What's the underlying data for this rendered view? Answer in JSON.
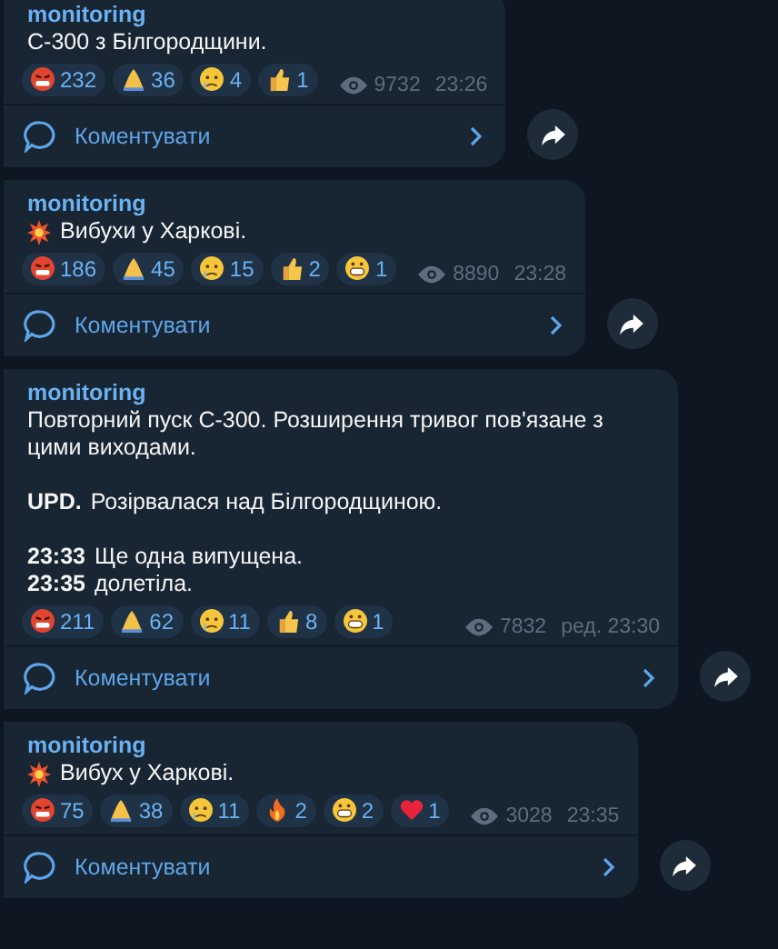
{
  "messages": [
    {
      "author": "monitoring",
      "kind": "plain",
      "paragraphs": [
        [
          "С-300 з Білгородщини."
        ]
      ],
      "reactions": [
        {
          "kind": "angry",
          "count": "232"
        },
        {
          "kind": "pray",
          "count": "36"
        },
        {
          "kind": "cry",
          "count": "4"
        },
        {
          "kind": "thumb",
          "count": "1"
        }
      ],
      "views": "9732",
      "time": "23:26",
      "comment": "Коментувати"
    },
    {
      "author": "monitoring",
      "kind": "explosion",
      "paragraphs": [
        [
          "Вибухи у Харкові."
        ]
      ],
      "reactions": [
        {
          "kind": "angry",
          "count": "186"
        },
        {
          "kind": "pray",
          "count": "45"
        },
        {
          "kind": "cry",
          "count": "15"
        },
        {
          "kind": "thumb",
          "count": "2"
        },
        {
          "kind": "grin",
          "count": "1"
        }
      ],
      "views": "8890",
      "time": "23:28",
      "comment": "Коментувати"
    },
    {
      "author": "monitoring",
      "kind": "plain",
      "paragraphs": [
        [
          "Повторний пуск С-300. Розширення тривог пов'язане з цими виходами."
        ],
        [
          "**UPD.** Розірвалася над Білгородщиною."
        ],
        [
          "**23:33** Ще одна випущена.",
          "**23:35** долетіла."
        ]
      ],
      "reactions": [
        {
          "kind": "angry",
          "count": "211"
        },
        {
          "kind": "pray",
          "count": "62"
        },
        {
          "kind": "cry",
          "count": "11"
        },
        {
          "kind": "thumb",
          "count": "8"
        },
        {
          "kind": "grin",
          "count": "1"
        }
      ],
      "views": "7832",
      "time": "ред. 23:30",
      "comment": "Коментувати"
    },
    {
      "author": "monitoring",
      "kind": "explosion",
      "paragraphs": [
        [
          "Вибух у Харкові."
        ]
      ],
      "reactions": [
        {
          "kind": "angry",
          "count": "75"
        },
        {
          "kind": "pray",
          "count": "38"
        },
        {
          "kind": "cry",
          "count": "11"
        },
        {
          "kind": "fire",
          "count": "2"
        },
        {
          "kind": "grin",
          "count": "2"
        },
        {
          "kind": "heart",
          "count": "1"
        }
      ],
      "views": "3028",
      "time": "23:35",
      "comment": "Коментувати"
    }
  ]
}
